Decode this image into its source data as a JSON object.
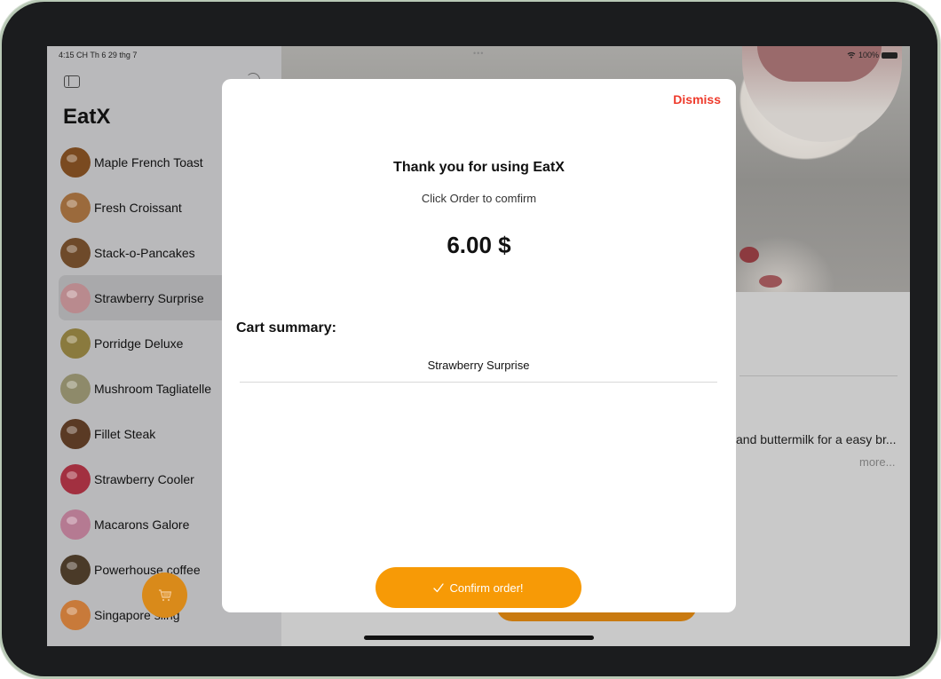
{
  "status_bar": {
    "time": "4:15 CH  Th 6 29 thg 7",
    "dots": "•••",
    "battery_text": "100%"
  },
  "sidebar": {
    "title": "EatX",
    "items": [
      {
        "label": "Maple French Toast",
        "color": "#7a4a20"
      },
      {
        "label": "Fresh Croissant",
        "color": "#9b6a3c"
      },
      {
        "label": "Stack-o-Pancakes",
        "color": "#6e4a2a"
      },
      {
        "label": "Strawberry Surprise",
        "color": "#b98a8e"
      },
      {
        "label": "Porridge Deluxe",
        "color": "#8a7a3e"
      },
      {
        "label": "Mushroom Tagliatelle",
        "color": "#8e8a6a"
      },
      {
        "label": "Fillet Steak",
        "color": "#5a3a24"
      },
      {
        "label": "Strawberry Cooler",
        "color": "#a23040"
      },
      {
        "label": "Macarons Galore",
        "color": "#b57a92"
      },
      {
        "label": "Powerhouse coffee",
        "color": "#4a3a28"
      },
      {
        "label": "Singapore sling",
        "color": "#c87a3a"
      }
    ],
    "selected_index": 3,
    "cart_icon": "cart-icon"
  },
  "detail": {
    "description": "and buttermilk for a easy br...",
    "more": "more..."
  },
  "modal": {
    "dismiss": "Dismiss",
    "heading": "Thank you for using EatX",
    "subheading": "Click Order to comfirm",
    "price": "6.00 $",
    "cart_summary_label": "Cart summary:",
    "cart_items": [
      "Strawberry Surprise"
    ],
    "confirm": "Confirm order!",
    "confirm_icon": "checkmark-icon"
  },
  "colors": {
    "accent": "#f79a06",
    "dismiss": "#ee3a2b"
  }
}
